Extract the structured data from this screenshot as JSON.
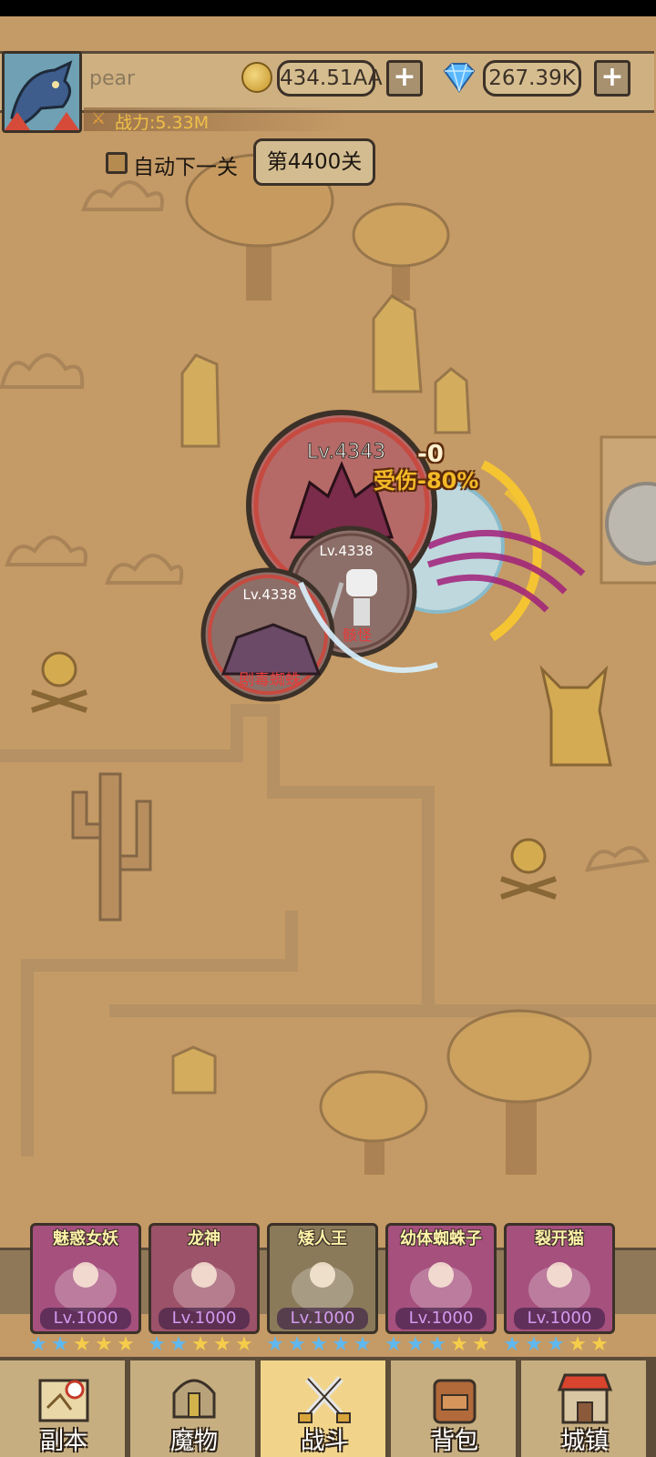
{
  "player": {
    "name": "pear",
    "power_label": "战力:5.33M"
  },
  "currency": {
    "gold": "434.51AA",
    "gems": "267.39K",
    "add_symbol": "+"
  },
  "controls": {
    "auto_next_label": "自动下一关",
    "auto_next_checked": false,
    "stage_label": "第4400关"
  },
  "battle": {
    "boss_level": "Lv.4343",
    "debuff_text": "受伤-80%",
    "damage_text": "-0",
    "enemies": [
      {
        "level": "Lv.4338",
        "name": "骸怪"
      },
      {
        "level": "Lv.4338",
        "name": "剧毒蜘蛛"
      }
    ]
  },
  "team": [
    {
      "name": "魅惑女妖",
      "level": "Lv.1000",
      "stars_blue": 2,
      "stars_gold": 3,
      "color": "#a6507e"
    },
    {
      "name": "龙神",
      "level": "Lv.1000",
      "stars_blue": 2,
      "stars_gold": 3,
      "color": "#9c5268"
    },
    {
      "name": "矮人王",
      "level": "Lv.1000",
      "stars_blue": 5,
      "stars_gold": 0,
      "color": "#8a7a5a"
    },
    {
      "name": "幼体蜘蛛子",
      "level": "Lv.1000",
      "stars_blue": 3,
      "stars_gold": 2,
      "color": "#a6507e"
    },
    {
      "name": "裂开猫",
      "level": "Lv.1000",
      "stars_blue": 3,
      "stars_gold": 2,
      "color": "#a6507e"
    }
  ],
  "nav": [
    {
      "label": "副本",
      "icon": "map-icon",
      "active": false
    },
    {
      "label": "魔物",
      "icon": "helmet-icon",
      "active": false
    },
    {
      "label": "战斗",
      "icon": "crossed-swords-icon",
      "active": true
    },
    {
      "label": "背包",
      "icon": "backpack-icon",
      "active": false
    },
    {
      "label": "城镇",
      "icon": "shop-icon",
      "active": false
    }
  ],
  "colors": {
    "map_bg": "#c49a66",
    "ui_border": "#3b3128",
    "active_tab": "#f1d48a",
    "star_blue": "#5fb8f0",
    "star_gold": "#f5cd4a"
  }
}
